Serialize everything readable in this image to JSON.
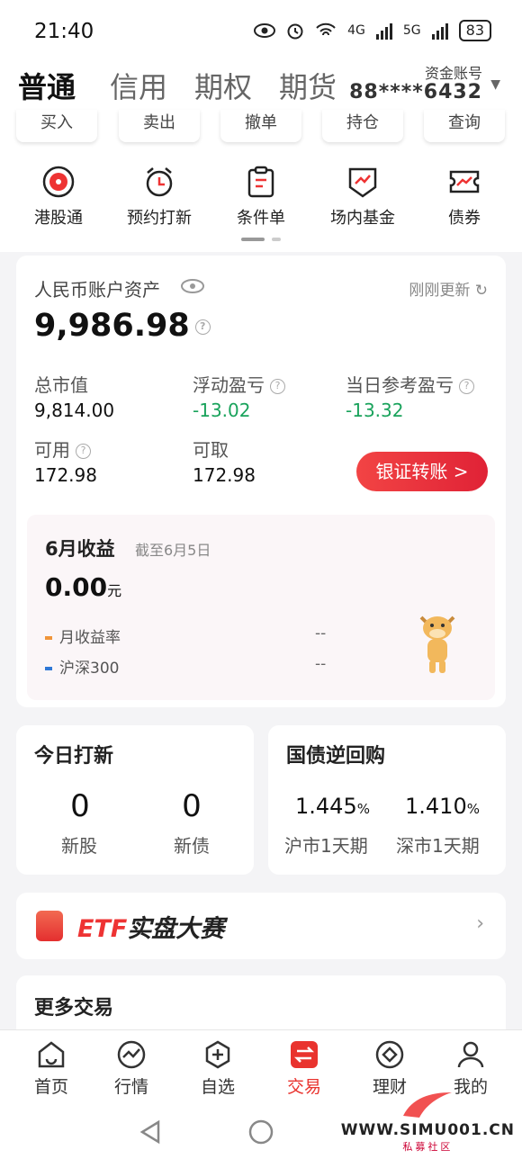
{
  "status_bar": {
    "time": "21:40",
    "net1": "4G",
    "net2": "5G",
    "battery": "83"
  },
  "tabs": [
    {
      "label": "普通",
      "active": true
    },
    {
      "label": "信用",
      "active": false
    },
    {
      "label": "期权",
      "active": false
    },
    {
      "label": "期货",
      "active": false
    }
  ],
  "account": {
    "label": "资金账号",
    "number": "88****6432"
  },
  "trade_buttons": [
    "买入",
    "卖出",
    "撤单",
    "持仓",
    "查询"
  ],
  "shortcuts": [
    {
      "label": "港股通",
      "icon": "hk-flower-icon"
    },
    {
      "label": "预约打新",
      "icon": "alarm-clock-icon"
    },
    {
      "label": "条件单",
      "icon": "clipboard-icon"
    },
    {
      "label": "场内基金",
      "icon": "fund-shield-icon"
    },
    {
      "label": "债券",
      "icon": "bond-ticket-icon"
    }
  ],
  "asset": {
    "title": "人民币账户资产",
    "updated": "刚刚更新",
    "total": "9,986.98",
    "market_value_label": "总市值",
    "market_value": "9,814.00",
    "floating_pl_label": "浮动盈亏",
    "floating_pl": "-13.02",
    "daily_pl_label": "当日参考盈亏",
    "daily_pl": "-13.32",
    "available_label": "可用",
    "available": "172.98",
    "withdrawable_label": "可取",
    "withdrawable": "172.98",
    "transfer_label": "银证转账 >"
  },
  "monthly": {
    "title": "6月收益",
    "date": "截至6月5日",
    "value": "0.00",
    "unit": "元",
    "legend": [
      {
        "label": "月收益率",
        "value": "--",
        "color": "#f0953a"
      },
      {
        "label": "沪深300",
        "value": "--",
        "color": "#2f78d6"
      }
    ]
  },
  "ipo": {
    "title": "今日打新",
    "stocks_count": "0",
    "stocks_label": "新股",
    "bonds_count": "0",
    "bonds_label": "新债"
  },
  "repo": {
    "title": "国债逆回购",
    "sh_rate": "1.445",
    "sz_rate": "1.410",
    "percent": "%",
    "sh_label": "沪市1天期",
    "sz_label": "深市1天期"
  },
  "etf_banner": {
    "prefix": "ETF",
    "title": "实盘大赛"
  },
  "more": {
    "title": "更多交易"
  },
  "nav": [
    {
      "label": "首页",
      "active": false
    },
    {
      "label": "行情",
      "active": false
    },
    {
      "label": "自选",
      "active": false
    },
    {
      "label": "交易",
      "active": true
    },
    {
      "label": "理财",
      "active": false
    },
    {
      "label": "我的",
      "active": false
    }
  ],
  "watermark": {
    "url": "WWW.SIMU001.CN",
    "sub": "私募社区"
  }
}
